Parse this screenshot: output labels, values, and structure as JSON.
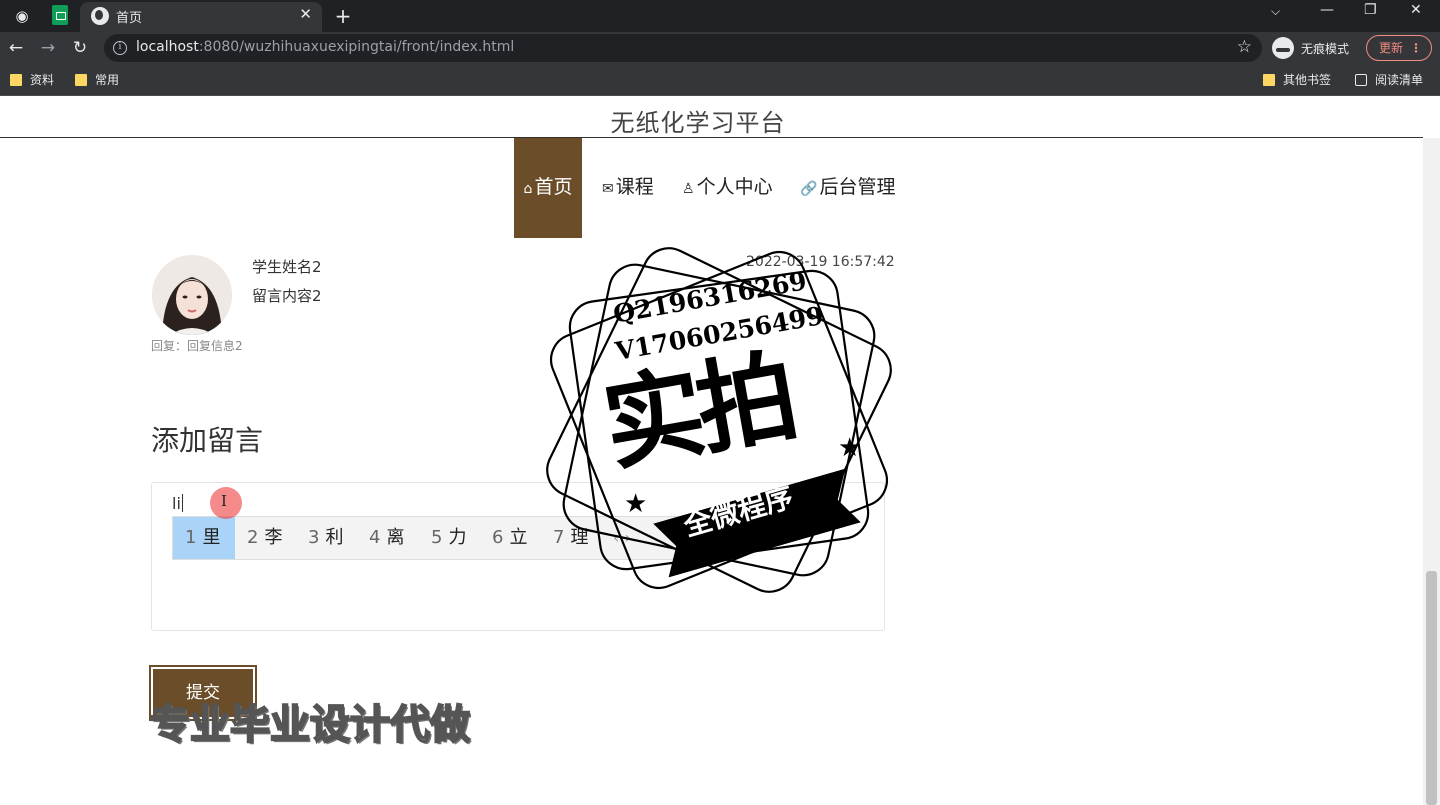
{
  "browser": {
    "tab_title": "首页",
    "url_host": "localhost",
    "url_rest": ":8080/wuzhihuaxuexipingtai/front/index.html",
    "incognito_label": "无痕模式",
    "update_label": "更新",
    "bookmarks": [
      "资料",
      "常用"
    ],
    "other_bookmarks": "其他书签",
    "reading_list": "阅读清单"
  },
  "site": {
    "title": "无纸化学习平台",
    "nav": [
      {
        "icon": "home-icon",
        "label": "首页"
      },
      {
        "icon": "mail-icon",
        "label": "课程"
      },
      {
        "icon": "user-icon",
        "label": "个人中心"
      },
      {
        "icon": "link-icon",
        "label": "后台管理"
      }
    ]
  },
  "message": {
    "student_name": "学生姓名2",
    "content": "留言内容2",
    "timestamp": "2022-03-19 16:57:42",
    "reply": "回复：回复信息2"
  },
  "form": {
    "title": "添加留言",
    "typed_text": "li",
    "submit_label": "提交"
  },
  "ime": {
    "candidates": [
      {
        "num": "1",
        "char": "里"
      },
      {
        "num": "2",
        "char": "李"
      },
      {
        "num": "3",
        "char": "利"
      },
      {
        "num": "4",
        "char": "离"
      },
      {
        "num": "5",
        "char": "力"
      },
      {
        "num": "6",
        "char": "立"
      },
      {
        "num": "7",
        "char": "理"
      }
    ],
    "arrows": "‹ ›"
  },
  "watermark": {
    "footer_text": "专业毕业设计代做",
    "stamp_q": "Q2196316269",
    "stamp_v": "V17060256499",
    "stamp_main": "实拍",
    "stamp_sub": "全微程序"
  }
}
